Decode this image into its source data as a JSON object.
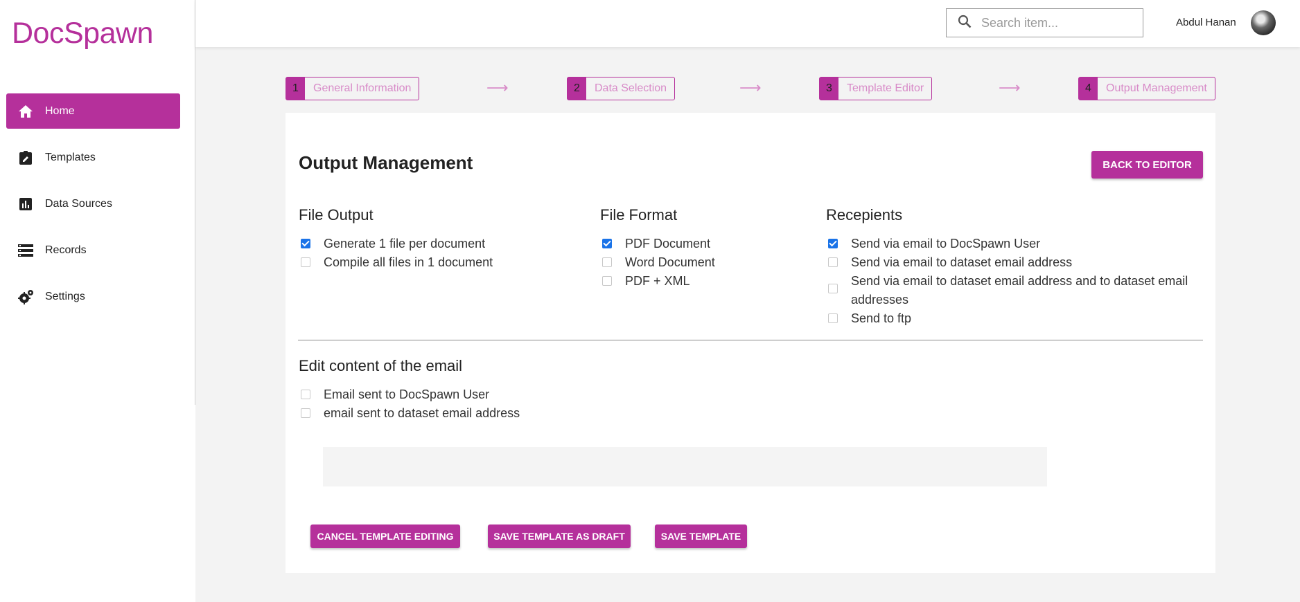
{
  "app": {
    "logo": "DocSpawn"
  },
  "sidebar": {
    "items": [
      {
        "label": "Home",
        "icon": "home-icon",
        "active": true
      },
      {
        "label": "Templates",
        "icon": "clipboard-edit-icon"
      },
      {
        "label": "Data Sources",
        "icon": "bar-chart-icon"
      },
      {
        "label": "Records",
        "icon": "list-icon"
      },
      {
        "label": "Settings",
        "icon": "gears-icon"
      }
    ]
  },
  "header": {
    "search_placeholder": "Search item...",
    "user_name": "Abdul Hanan"
  },
  "stepper": {
    "steps": [
      {
        "num": "1",
        "label": "General Information"
      },
      {
        "num": "2",
        "label": "Data Selection"
      },
      {
        "num": "3",
        "label": "Template Editor"
      },
      {
        "num": "4",
        "label": "Output Management"
      }
    ],
    "arrow": "⟶"
  },
  "main": {
    "title": "Output Management",
    "back_button": "BACK TO EDITOR",
    "file_output": {
      "heading": "File Output",
      "options": [
        {
          "label": "Generate 1 file per document",
          "checked": true
        },
        {
          "label": "Compile all files in 1 document",
          "checked": false
        }
      ]
    },
    "file_format": {
      "heading": "File Format",
      "options": [
        {
          "label": "PDF Document",
          "checked": true
        },
        {
          "label": "Word Document",
          "checked": false
        },
        {
          "label": "PDF + XML",
          "checked": false
        }
      ]
    },
    "recipients": {
      "heading": "Recepients",
      "options": [
        {
          "label": "Send via email to DocSpawn User",
          "checked": true
        },
        {
          "label": "Send via email to dataset email address",
          "checked": false
        },
        {
          "label": "Send via email to dataset email address and to dataset email addresses",
          "checked": false
        },
        {
          "label": "Send to ftp",
          "checked": false
        }
      ]
    },
    "email_content": {
      "heading": "Edit content of the email",
      "options": [
        {
          "label": "Email sent to DocSpawn User",
          "checked": false
        },
        {
          "label": "email sent to dataset email address",
          "checked": false
        }
      ]
    },
    "actions": {
      "cancel": "CANCEL TEMPLATE EDITING",
      "draft": "SAVE TEMPLATE AS DRAFT",
      "save": "SAVE TEMPLATE"
    }
  },
  "colors": {
    "accent": "#b5309b",
    "accent_light": "#d88bc8",
    "checkbox": "#1a73e8"
  }
}
